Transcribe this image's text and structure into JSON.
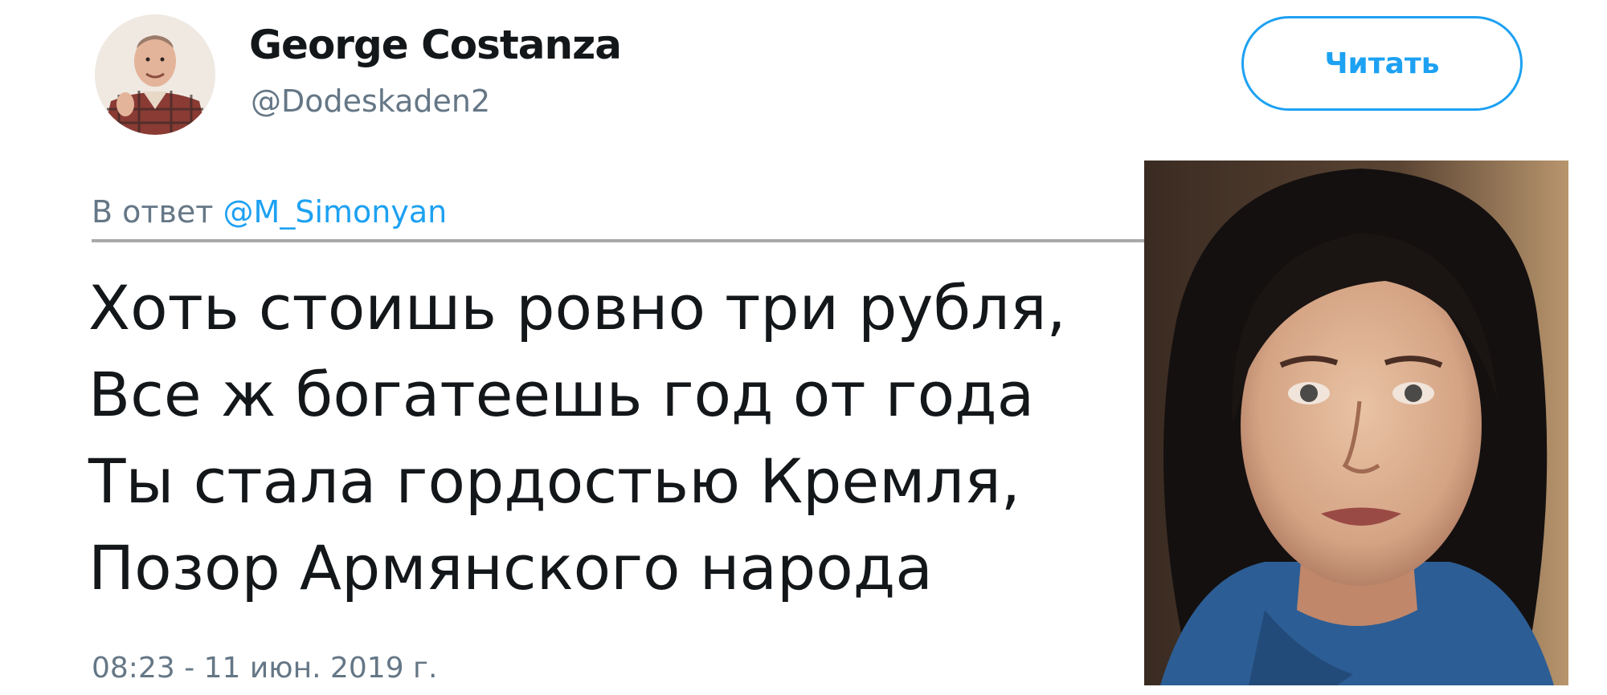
{
  "user": {
    "display_name": "George Costanza",
    "handle": "@Dodeskaden2",
    "avatar_icon": "user-avatar-photo"
  },
  "follow_button": {
    "label": "Читать",
    "color": "#1da1f2"
  },
  "reply": {
    "prefix": "В ответ",
    "mention": "@M_Simonyan"
  },
  "tweet": {
    "lines": [
      "Хоть стоишь ровно три рубля,",
      "Все ж богатеешь год от года",
      "Ты стала гордостью Кремля,",
      "Позор Армянского народа"
    ],
    "timestamp": "08:23 - 11 июн. 2019 г."
  },
  "colors": {
    "accent": "#1da1f2",
    "secondary_text": "#657786",
    "primary_text": "#14171a"
  }
}
